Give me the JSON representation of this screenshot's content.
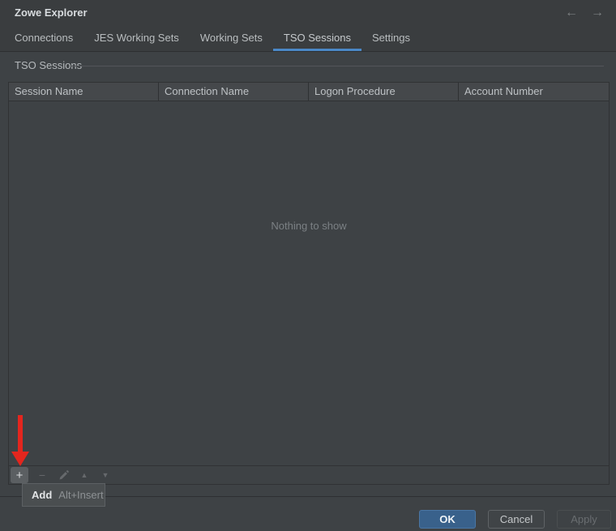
{
  "window": {
    "title": "Zowe Explorer"
  },
  "nav": {
    "back_icon": "←",
    "forward_icon": "→"
  },
  "tabs": [
    {
      "label": "Connections",
      "active": false
    },
    {
      "label": "JES Working Sets",
      "active": false
    },
    {
      "label": "Working Sets",
      "active": false
    },
    {
      "label": "TSO Sessions",
      "active": true
    },
    {
      "label": "Settings",
      "active": false
    }
  ],
  "section": {
    "label": "TSO Sessions"
  },
  "table": {
    "columns": [
      "Session Name",
      "Connection Name",
      "Logon Procedure",
      "Account Number"
    ],
    "empty_text": "Nothing to show"
  },
  "toolbar": {
    "add_icon": "+",
    "remove_icon": "−",
    "up_icon": "▲",
    "down_icon": "▼"
  },
  "tooltip": {
    "label": "Add",
    "shortcut": "Alt+Insert"
  },
  "footer": {
    "ok": "OK",
    "cancel": "Cancel",
    "apply": "Apply"
  },
  "colors": {
    "accent_underline": "#4a88c7",
    "primary_button": "#39618b",
    "annotation_red": "#e3261e"
  }
}
